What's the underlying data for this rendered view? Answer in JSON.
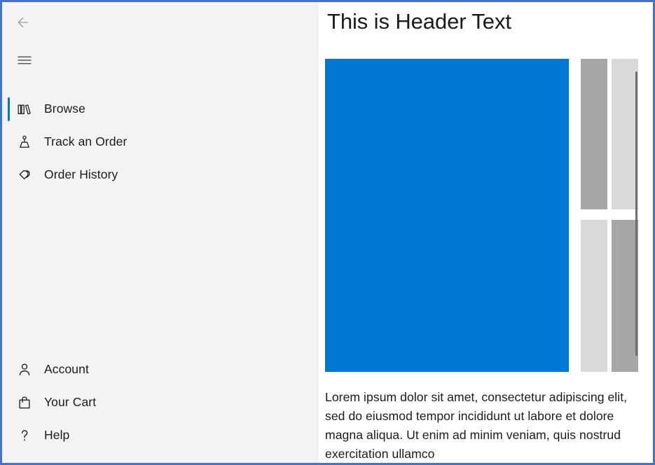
{
  "window": {
    "frame_color": "#4472c4"
  },
  "nav": {
    "back_icon": "back-arrow-icon",
    "menu_icon": "hamburger-menu-icon",
    "accent_color": "#0078d7",
    "background_color": "#f3f3f3",
    "primary_items": [
      {
        "label": "Browse",
        "icon": "books-icon",
        "selected": true
      },
      {
        "label": "Track an Order",
        "icon": "package-person-icon",
        "selected": false
      },
      {
        "label": "Order History",
        "icon": "tags-icon",
        "selected": false
      }
    ],
    "footer_items": [
      {
        "label": "Account",
        "icon": "person-icon",
        "selected": false
      },
      {
        "label": "Your Cart",
        "icon": "shopping-bag-icon",
        "selected": false
      },
      {
        "label": "Help",
        "icon": "question-mark-icon",
        "selected": false
      }
    ]
  },
  "content": {
    "header": "This is Header Text",
    "gallery": {
      "hero_color": "#0078d4",
      "blocks": [
        {
          "name": "hero-image-placeholder",
          "color": "#0078d4"
        },
        {
          "name": "thumbnail-placeholder-top-1",
          "color": "#a6a6a6"
        },
        {
          "name": "thumbnail-placeholder-top-2",
          "color": "#d9d9d9"
        },
        {
          "name": "thumbnail-placeholder-bottom-1",
          "color": "#d9d9d9"
        },
        {
          "name": "thumbnail-placeholder-bottom-2",
          "color": "#a6a6a6"
        }
      ]
    },
    "body_text": "Lorem ipsum dolor sit amet, consectetur adipiscing elit, sed do eiusmod tempor incididunt ut labore et dolore magna aliqua. Ut enim ad minim veniam, quis nostrud exercitation ullamco"
  }
}
